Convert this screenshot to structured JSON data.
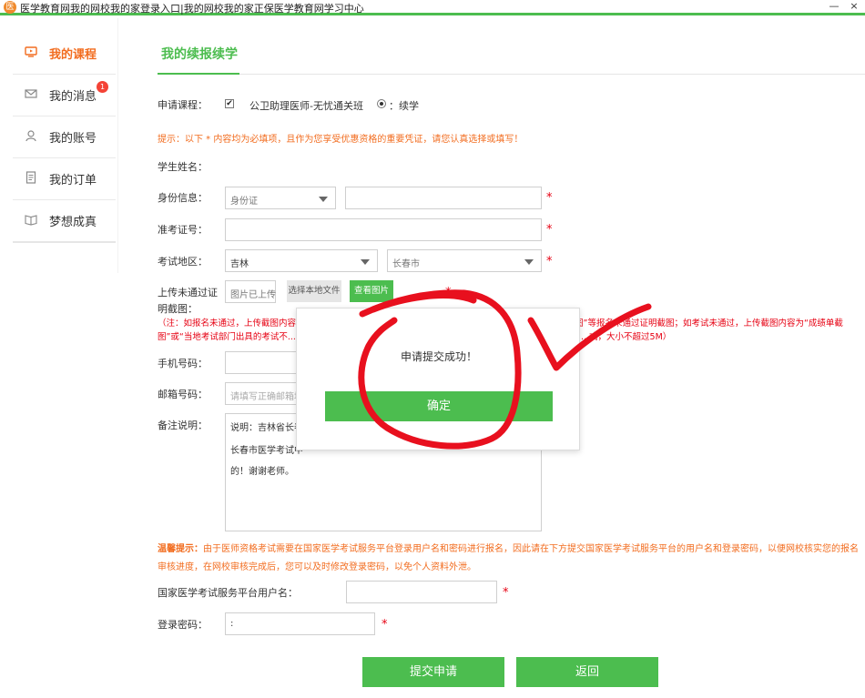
{
  "window": {
    "title": "医学教育网我的网校我的家登录入口|我的网校我的家正保医学教育网学习中心",
    "logo_glyph": "医",
    "minimize": "—",
    "close": "×"
  },
  "sidebar": {
    "items": [
      {
        "label": "我的课程",
        "icon": "course-icon",
        "active": true
      },
      {
        "label": "我的消息",
        "icon": "mail-icon",
        "badge": "1"
      },
      {
        "label": "我的账号",
        "icon": "user-icon"
      },
      {
        "label": "我的订单",
        "icon": "order-icon"
      },
      {
        "label": "梦想成真",
        "icon": "book-icon"
      }
    ]
  },
  "main": {
    "title": "我的续报续学",
    "course": {
      "label": "申请课程：",
      "name": "公卫助理医师-无忧通关班",
      "option": "：续学"
    },
    "tip": "提示：以下 * 内容均为必填项，且作为您享受优惠资格的重要凭证，请您认真选择或填写！",
    "student_name_label": "学生姓名：",
    "id_label": "身份信息：",
    "id_type": "身份证",
    "id_value": "",
    "exam_no_label": "准考证号：",
    "exam_no_value": "",
    "region_label": "考试地区：",
    "province": "吉林",
    "city": "长春市",
    "upload_label_1": "上传未通过证",
    "upload_label_2": "明截图：",
    "uploaded_text": "图片已上传",
    "choose_file": "选择本地文件",
    "view_image": "查看图片",
    "upload_note_1": "（注：如报名未通过，上传截图内容为“...",
    "upload_note_1b": "...图”等报名未通过证明截图；如考试未通过，上传截图内容为“成绩单截",
    "upload_note_2": "图”或“当地考试部门出具的考试不...",
    "upload_note_2b": "...式，大小不超过5M）",
    "phone_label": "手机号码：",
    "email_label": "邮箱号码：",
    "email_placeholder": "请填写正确邮箱地",
    "remark_label": "备注说明：",
    "remark_lines": [
      "说明：吉林省长春",
      "长春市医学考试中",
      "的！谢谢老师。"
    ],
    "warm_title": "温馨提示：",
    "warm_text": "由于医师资格考试需要在国家医学考试服务平台登录用户名和密码进行报名，因此请在下方提交国家医学考试服务平台的用户名和登录密码，以便网校核实您的报名审核进度，在网校审核完成后，您可以及时修改登录密码，以免个人资料外泄。",
    "platform_user_label": "国家医学考试服务平台用户名：",
    "platform_user_value": "",
    "password_label": "登录密码：",
    "password_value": ":",
    "required_mark": "*",
    "submit": "提交申请",
    "back": "返回"
  },
  "modal": {
    "message": "申请提交成功！",
    "ok": "确定"
  },
  "colors": {
    "accent": "#4cbd4f",
    "orange": "#f26d20",
    "red": "#e60012",
    "annotation": "#e8101e"
  }
}
